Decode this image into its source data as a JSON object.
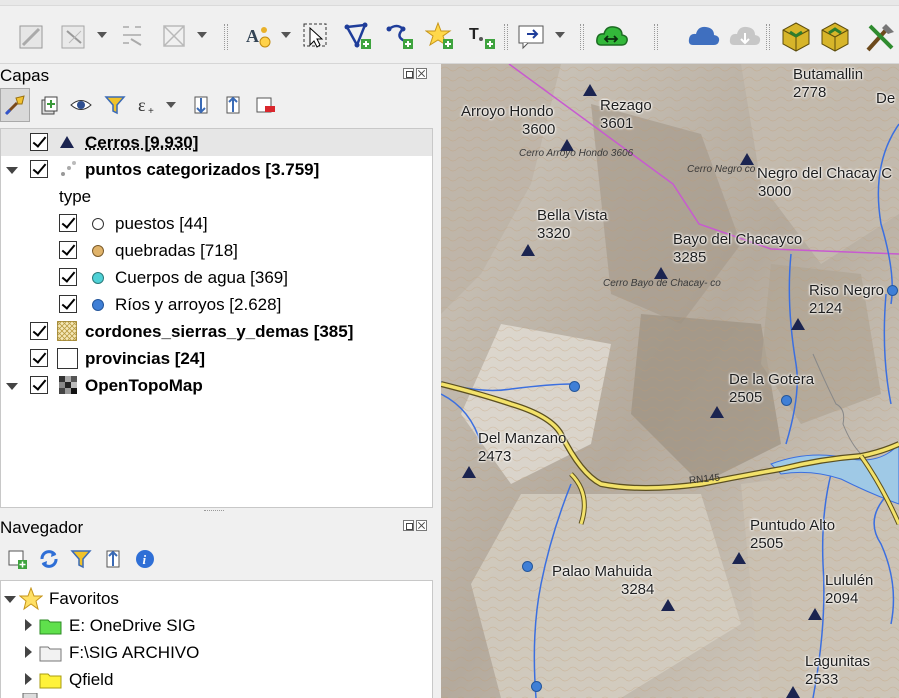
{
  "toolbar": {
    "icons": [
      "edit-pencil-icon",
      "vertex-tool-icon",
      "digitize-icon",
      "node-tool-icon",
      "label-settings-icon",
      "select-feature-icon",
      "add-polygon-icon",
      "add-line-icon",
      "add-point-favorite-icon",
      "text-annotation-icon",
      "map-tip-icon",
      "cloud-sync-icon",
      "cloud-icon",
      "cloud-download-icon",
      "3d-box-icon",
      "3d-box-2-icon",
      "tools-icon"
    ]
  },
  "layers_panel": {
    "title": "Capas",
    "layers": [
      {
        "label": "Cerros [9.930]",
        "checked": true,
        "bold": true,
        "underline": true,
        "symbol": "triangle",
        "selected": true
      },
      {
        "label": "puntos categorizados [3.759]",
        "checked": true,
        "bold": true,
        "symbol": "dots",
        "expanded": true
      },
      {
        "label": "type",
        "kind": "heading"
      },
      {
        "label": "puestos [44]",
        "checked": true,
        "symbol_color": "#ffffff"
      },
      {
        "label": "quebradas [718]",
        "checked": true,
        "symbol_color": "#e0b36a"
      },
      {
        "label": "Cuerpos de agua [369]",
        "checked": true,
        "symbol_color": "#4fd1d6"
      },
      {
        "label": "Ríos y arroyos [2.628]",
        "checked": true,
        "symbol_color": "#3f7fd6"
      },
      {
        "label": "cordones_sierras_y_demas [385]",
        "checked": true,
        "bold": true,
        "symbol": "hatch"
      },
      {
        "label": "provincias [24]",
        "checked": true,
        "bold": true,
        "symbol": "empty-box"
      },
      {
        "label": "OpenTopoMap",
        "checked": true,
        "bold": true,
        "symbol": "raster",
        "expanded": true
      }
    ]
  },
  "browser_panel": {
    "title": "Navegador",
    "items": [
      {
        "label": "Favoritos",
        "icon": "star-icon",
        "expanded": true
      },
      {
        "label": "E: OneDrive SIG",
        "icon": "green-folder-icon"
      },
      {
        "label": "F:\\SIG ARCHIVO",
        "icon": "folder-icon"
      },
      {
        "label": "Qfield",
        "icon": "yellow-folder-icon"
      }
    ]
  },
  "map": {
    "peaks": [
      {
        "name": "Butamallin",
        "elev": "2778"
      },
      {
        "name": "De",
        "elev": ""
      },
      {
        "name": "Arroyo Hondo",
        "elev": "3600",
        "italic": "Cerro Arroyo Hondo 3606"
      },
      {
        "name": "Rezago",
        "elev": "3601"
      },
      {
        "name": "Negro del Chacay C",
        "elev": "3000",
        "italic": "Cerro Negro co"
      },
      {
        "name": "Bella Vista",
        "elev": "3320"
      },
      {
        "name": "Bayo del Chacayco",
        "elev": "3285",
        "italic": "Cerro Bayo de Chacay- co"
      },
      {
        "name": "Riso Negro",
        "elev": "2124"
      },
      {
        "name": "De la Gotera",
        "elev": "2505"
      },
      {
        "name": "Del Manzano",
        "elev": "2473"
      },
      {
        "name": "Puntudo Alto",
        "elev": "2505"
      },
      {
        "name": "Palao Mahuida",
        "elev": "3284"
      },
      {
        "name": "Lululén",
        "elev": "2094"
      },
      {
        "name": "Lagunitas",
        "elev": "2533"
      }
    ],
    "road_label": "RN145"
  }
}
